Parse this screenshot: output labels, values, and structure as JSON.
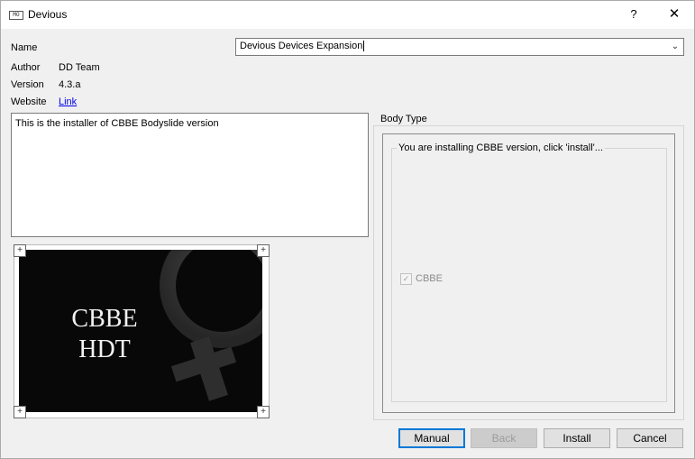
{
  "window": {
    "title": "Devious",
    "help_glyph": "?",
    "close_glyph": "✕",
    "icon": "app-icon"
  },
  "info": {
    "name_label": "Name",
    "name_value": "Devious Devices Expansion",
    "author_label": "Author",
    "author_value": "DD Team",
    "version_label": "Version",
    "version_value": "4.3.a",
    "website_label": "Website",
    "website_link": "Link"
  },
  "description": "This is the installer of CBBE Bodyslide version",
  "image": {
    "line1": "CBBE",
    "line2": "HDT"
  },
  "body_type": {
    "title": "Body Type",
    "instruction": "You are installing CBBE version, click 'install'...",
    "option_label": "CBBE",
    "option_checked": true,
    "option_enabled": false
  },
  "buttons": {
    "manual": "Manual",
    "back": "Back",
    "install": "Install",
    "cancel": "Cancel"
  }
}
